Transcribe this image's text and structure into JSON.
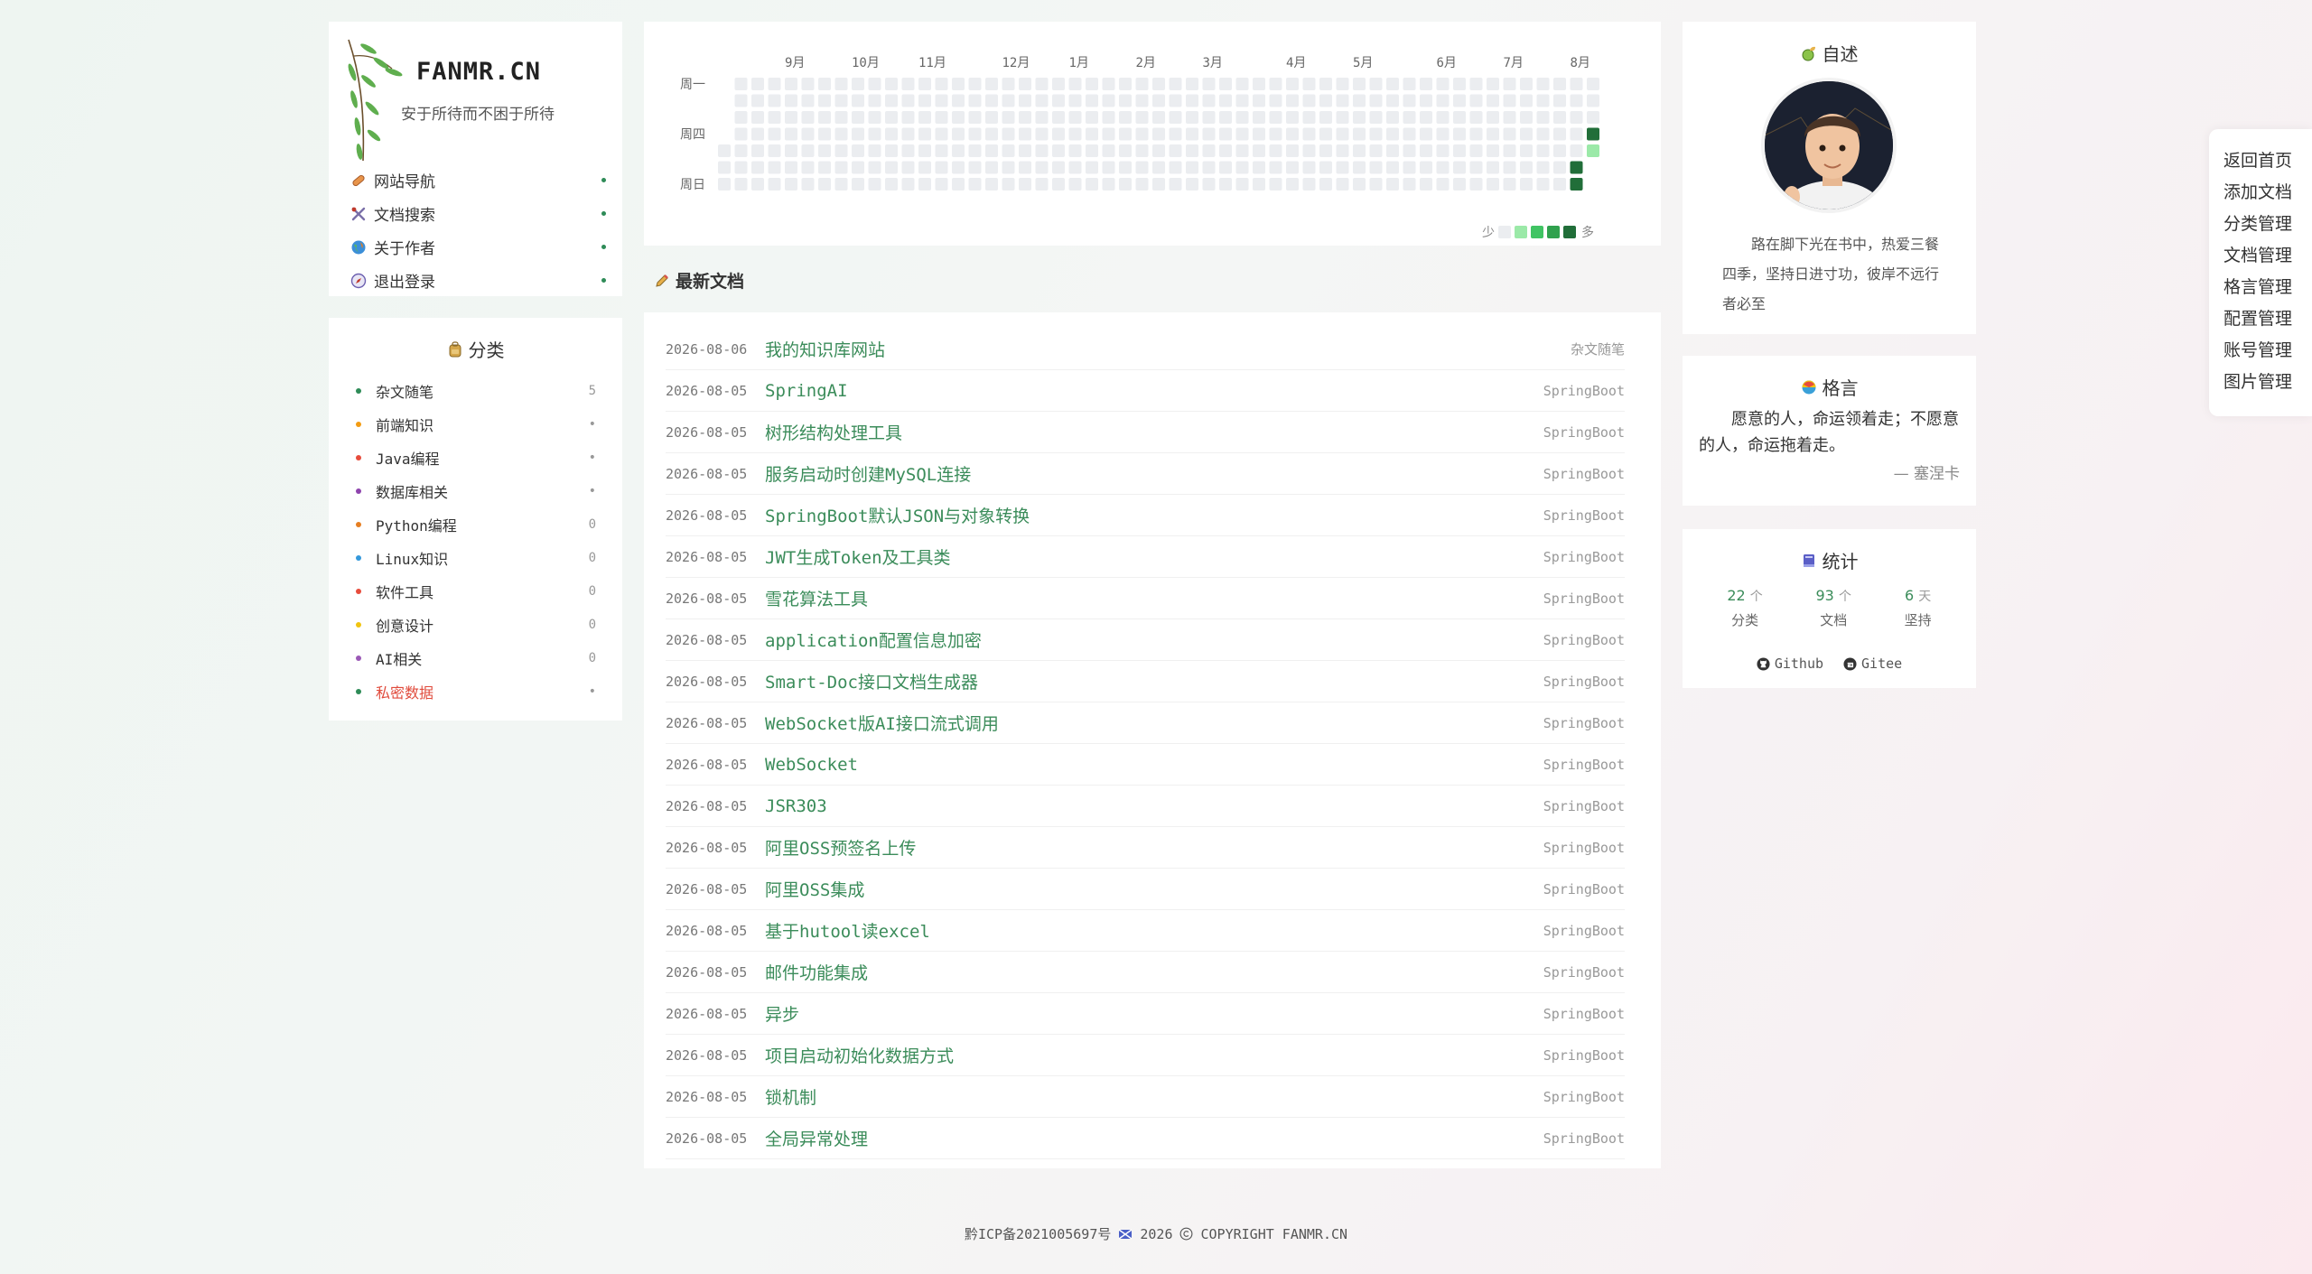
{
  "brand": {
    "title": "FANMR.CN",
    "subtitle": "安于所待而不困于所待"
  },
  "nav": [
    {
      "label": "网站导航",
      "icon": "pill-icon"
    },
    {
      "label": "文档搜索",
      "icon": "tools-icon"
    },
    {
      "label": "关于作者",
      "icon": "globe-icon"
    },
    {
      "label": "退出登录",
      "icon": "compass-icon"
    }
  ],
  "categories": {
    "title": "分类",
    "items": [
      {
        "label": "杂文随笔",
        "count": "5",
        "color": "#2e8b57"
      },
      {
        "label": "前端知识",
        "count": "•",
        "color": "#f39c12"
      },
      {
        "label": "Java编程",
        "count": "•",
        "color": "#e74c3c"
      },
      {
        "label": "数据库相关",
        "count": "•",
        "color": "#8e44ad"
      },
      {
        "label": "Python编程",
        "count": "0",
        "color": "#e67e22"
      },
      {
        "label": "Linux知识",
        "count": "0",
        "color": "#3498db"
      },
      {
        "label": "软件工具",
        "count": "0",
        "color": "#e74c3c"
      },
      {
        "label": "创意设计",
        "count": "0",
        "color": "#f1c40f"
      },
      {
        "label": "AI相关",
        "count": "0",
        "color": "#9b59b6"
      },
      {
        "label": "私密数据",
        "count": "•",
        "color": "#2e8b57",
        "red": true
      }
    ]
  },
  "heatmap": {
    "months": [
      "9月",
      "10月",
      "11月",
      "12月",
      "1月",
      "2月",
      "3月",
      "4月",
      "5月",
      "6月",
      "7月",
      "8月"
    ],
    "weekday_labels": [
      "周一",
      "周四",
      "周日"
    ],
    "legend_less": "少",
    "legend_more": "多",
    "colors": [
      "#ebedf0",
      "#9be9a8",
      "#40c463",
      "#30a14e",
      "#216e39"
    ],
    "active": [
      {
        "week": 52,
        "day": 3,
        "level": 4
      },
      {
        "week": 52,
        "day": 4,
        "level": 1
      },
      {
        "week": 51,
        "day": 5,
        "level": 4
      },
      {
        "week": 51,
        "day": 6,
        "level": 4
      }
    ]
  },
  "docs_section": {
    "title": "最新文档"
  },
  "docs": [
    {
      "date": "2026-08-06",
      "title": "我的知识库网站",
      "category": "杂文随笔"
    },
    {
      "date": "2026-08-05",
      "title": "SpringAI",
      "category": "SpringBoot"
    },
    {
      "date": "2026-08-05",
      "title": "树形结构处理工具",
      "category": "SpringBoot"
    },
    {
      "date": "2026-08-05",
      "title": "服务启动时创建MySQL连接",
      "category": "SpringBoot"
    },
    {
      "date": "2026-08-05",
      "title": "SpringBoot默认JSON与对象转换",
      "category": "SpringBoot"
    },
    {
      "date": "2026-08-05",
      "title": "JWT生成Token及工具类",
      "category": "SpringBoot"
    },
    {
      "date": "2026-08-05",
      "title": "雪花算法工具",
      "category": "SpringBoot"
    },
    {
      "date": "2026-08-05",
      "title": "application配置信息加密",
      "category": "SpringBoot"
    },
    {
      "date": "2026-08-05",
      "title": "Smart-Doc接口文档生成器",
      "category": "SpringBoot"
    },
    {
      "date": "2026-08-05",
      "title": "WebSocket版AI接口流式调用",
      "category": "SpringBoot"
    },
    {
      "date": "2026-08-05",
      "title": "WebSocket",
      "category": "SpringBoot"
    },
    {
      "date": "2026-08-05",
      "title": "JSR303",
      "category": "SpringBoot"
    },
    {
      "date": "2026-08-05",
      "title": "阿里OSS预签名上传",
      "category": "SpringBoot"
    },
    {
      "date": "2026-08-05",
      "title": "阿里OSS集成",
      "category": "SpringBoot"
    },
    {
      "date": "2026-08-05",
      "title": "基于hutool读excel",
      "category": "SpringBoot"
    },
    {
      "date": "2026-08-05",
      "title": "邮件功能集成",
      "category": "SpringBoot"
    },
    {
      "date": "2026-08-05",
      "title": "异步",
      "category": "SpringBoot"
    },
    {
      "date": "2026-08-05",
      "title": "项目启动初始化数据方式",
      "category": "SpringBoot"
    },
    {
      "date": "2026-08-05",
      "title": "锁机制",
      "category": "SpringBoot"
    },
    {
      "date": "2026-08-05",
      "title": "全局异常处理",
      "category": "SpringBoot"
    }
  ],
  "about": {
    "title": "自述",
    "text": "路在脚下光在书中，热爱三餐四季，坚持日进寸功，彼岸不远行者必至"
  },
  "motto": {
    "title": "格言",
    "text": "愿意的人，命运领着走；不愿意的人，命运拖着走。",
    "author": "— 塞涅卡"
  },
  "stats": {
    "title": "统计",
    "items": [
      {
        "num": "22",
        "unit": "个",
        "label": "分类"
      },
      {
        "num": "93",
        "unit": "个",
        "label": "文档"
      },
      {
        "num": "6",
        "unit": "天",
        "label": "坚持"
      }
    ],
    "links": [
      {
        "label": "Github",
        "icon": "github-icon"
      },
      {
        "label": "Gitee",
        "icon": "gitee-icon"
      }
    ]
  },
  "admin_menu": [
    "返回首页",
    "添加文档",
    "分类管理",
    "文档管理",
    "格言管理",
    "配置管理",
    "账号管理",
    "图片管理"
  ],
  "footer": {
    "icp": "黔ICP备2021005697号",
    "year": "2026",
    "copyright": "COPYRIGHT FANMR.CN"
  }
}
